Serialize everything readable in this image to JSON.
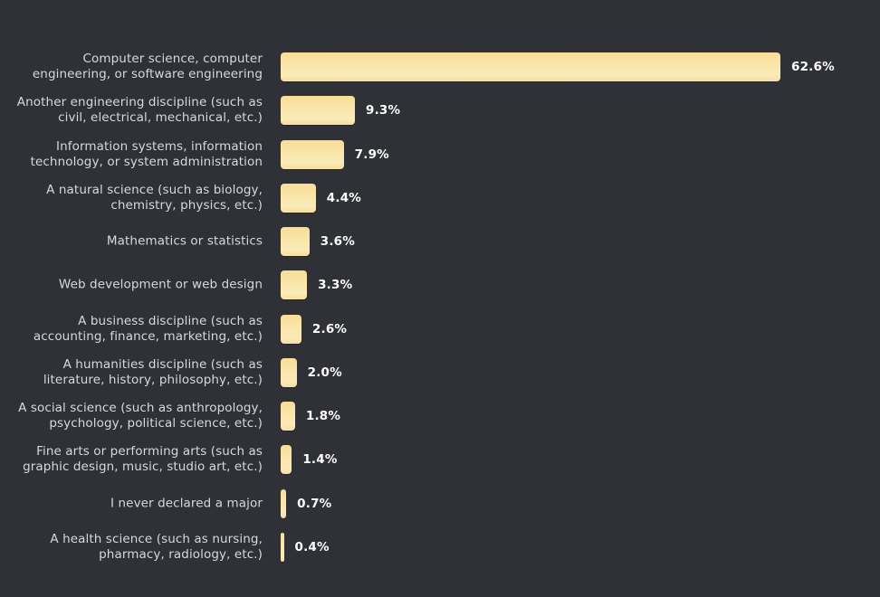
{
  "background_color": "#2f3136",
  "bar_color": "#fae5a8",
  "label_color": "#d7d9db",
  "value_color": "#ffffff",
  "chart_data": {
    "type": "bar",
    "orientation": "horizontal",
    "title": "",
    "subtitle": "",
    "xlabel": "",
    "ylabel": "",
    "grid": false,
    "legend": null,
    "xlim": [
      0,
      62.6
    ],
    "value_suffix": "%",
    "categories": [
      "Computer science, computer engineering, or software engineering",
      "Another engineering discipline (such as civil, electrical, mechanical, etc.)",
      "Information systems, information technology, or system administration",
      "A natural science (such as biology, chemistry, physics, etc.)",
      "Mathematics or statistics",
      "Web development or web design",
      "A business discipline (such as accounting, finance, marketing, etc.)",
      "A humanities discipline (such as literature, history, philosophy, etc.)",
      "A social science (such as anthropology, psychology, political science, etc.)",
      "Fine arts or performing arts (such as graphic design, music, studio art, etc.)",
      "I never declared a major",
      "A health science (such as nursing, pharmacy, radiology, etc.)"
    ],
    "values": [
      62.6,
      9.3,
      7.9,
      4.4,
      3.6,
      3.3,
      2.6,
      2.0,
      1.8,
      1.4,
      0.7,
      0.4
    ],
    "value_labels": [
      "62.6%",
      "9.3%",
      "7.9%",
      "4.4%",
      "3.6%",
      "3.3%",
      "2.6%",
      "2.0%",
      "1.8%",
      "1.4%",
      "0.7%",
      "0.4%"
    ]
  }
}
